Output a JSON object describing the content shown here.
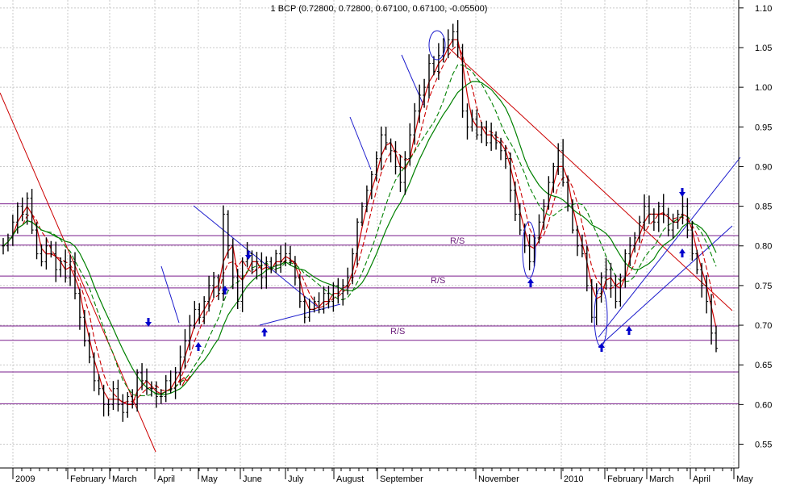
{
  "chart_data": {
    "type": "candlestick",
    "title": "1 BCP (0.72800, 0.72800, 0.67100, 0.67100, -0.05500)",
    "y_axis": {
      "position": "right",
      "ylim": [
        0.52,
        1.11
      ],
      "ticks": [
        0.55,
        0.6,
        0.65,
        0.7,
        0.75,
        0.8,
        0.85,
        0.9,
        0.95,
        1.0,
        1.05,
        1.1
      ],
      "tick_labels": [
        "0.55",
        "0.60",
        "0.65",
        "0.70",
        "0.75",
        "0.80",
        "0.85",
        "0.90",
        "0.95",
        "1.00",
        "1.05",
        "1.10"
      ]
    },
    "x_axis": {
      "labels": [
        "2009",
        "February",
        "March",
        "April",
        "May",
        "June",
        "July",
        "August",
        "September",
        "November",
        "2010",
        "February",
        "March",
        "April",
        "May"
      ]
    },
    "grid": true,
    "horizontal_levels": [
      0.601,
      0.641,
      0.681,
      0.699,
      0.747,
      0.762,
      0.801,
      0.813,
      0.853
    ],
    "annotations": [
      "R/S",
      "R/S",
      "R/S"
    ],
    "price_series": [
      0.8,
      0.81,
      0.83,
      0.85,
      0.84,
      0.86,
      0.82,
      0.79,
      0.78,
      0.8,
      0.79,
      0.77,
      0.78,
      0.76,
      0.78,
      0.74,
      0.71,
      0.68,
      0.66,
      0.63,
      0.62,
      0.6,
      0.6,
      0.62,
      0.6,
      0.59,
      0.61,
      0.6,
      0.64,
      0.63,
      0.62,
      0.62,
      0.61,
      0.61,
      0.63,
      0.62,
      0.64,
      0.66,
      0.68,
      0.7,
      0.72,
      0.71,
      0.73,
      0.75,
      0.76,
      0.74,
      0.84,
      0.8,
      0.76,
      0.73,
      0.78,
      0.79,
      0.77,
      0.78,
      0.76,
      0.78,
      0.77,
      0.79,
      0.78,
      0.79,
      0.78,
      0.76,
      0.73,
      0.71,
      0.72,
      0.73,
      0.72,
      0.74,
      0.73,
      0.75,
      0.74,
      0.75,
      0.76,
      0.79,
      0.83,
      0.85,
      0.87,
      0.89,
      0.91,
      0.94,
      0.93,
      0.92,
      0.9,
      0.88,
      0.91,
      0.94,
      0.97,
      0.99,
      1.0,
      1.03,
      1.02,
      1.04,
      1.05,
      1.06,
      1.07,
      1.05,
      0.97,
      0.95,
      0.96,
      0.94,
      0.95,
      0.93,
      0.94,
      0.93,
      0.92,
      0.91,
      0.87,
      0.84,
      0.82,
      0.8,
      0.78,
      0.81,
      0.83,
      0.85,
      0.88,
      0.9,
      0.92,
      0.88,
      0.85,
      0.82,
      0.8,
      0.79,
      0.75,
      0.71,
      0.74,
      0.76,
      0.77,
      0.75,
      0.73,
      0.76,
      0.79,
      0.8,
      0.81,
      0.83,
      0.85,
      0.84,
      0.83,
      0.85,
      0.84,
      0.82,
      0.83,
      0.84,
      0.85,
      0.82,
      0.79,
      0.77,
      0.75,
      0.73,
      0.69,
      0.671
    ],
    "series": [
      {
        "name": "",
        "color": "#000000",
        "style": "candles"
      },
      {
        "name": "",
        "color": "#cc0000",
        "style": "moving-average-short"
      },
      {
        "name": "",
        "color": "#cc0000",
        "style": "moving-average-dashed"
      },
      {
        "name": "",
        "color": "#008000",
        "style": "moving-average-long"
      },
      {
        "name": "",
        "color": "#008000",
        "style": "moving-average-dashed"
      }
    ],
    "colors": {
      "price": "#000000",
      "ma": "#cc0000",
      "ma_long": "#008000",
      "levels": "#7a1c8c",
      "trend_red": "#cc0000",
      "trend_blue": "#1a1acc",
      "arrows": "#0000cc",
      "grid": "#c8c8c8"
    }
  }
}
